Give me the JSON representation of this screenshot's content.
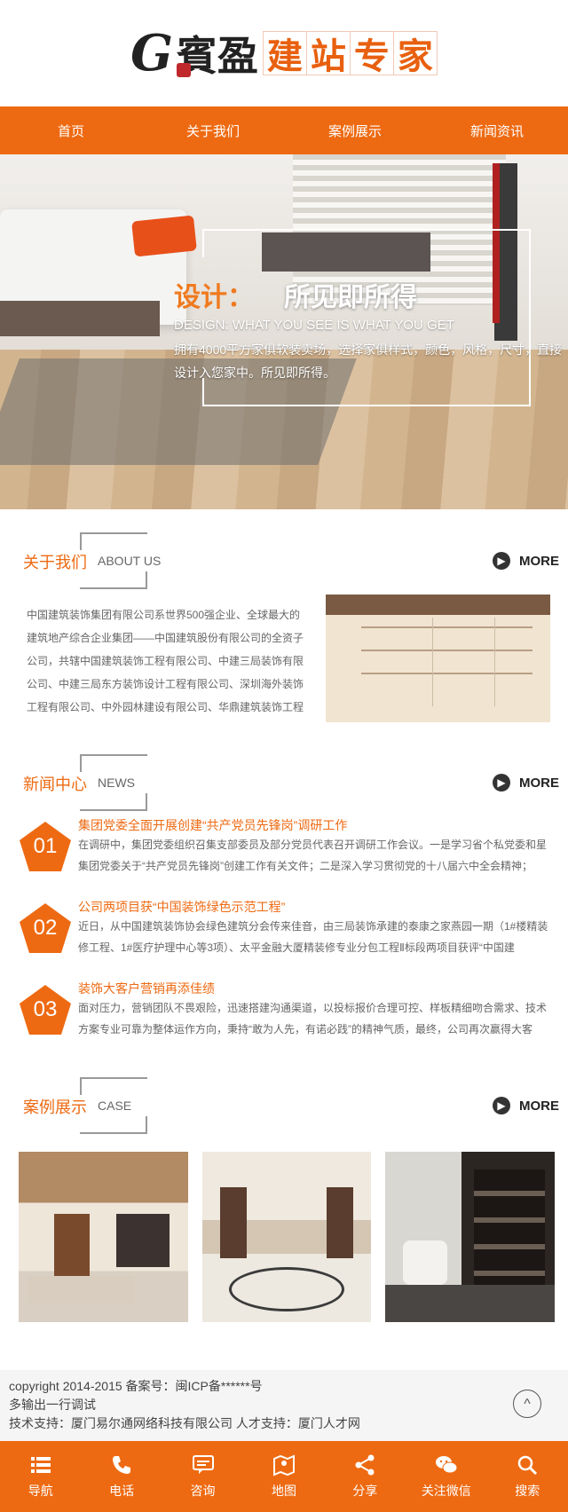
{
  "header": {
    "logo_mark": "G",
    "logo_word": "賓盈",
    "slogan": [
      "建",
      "站",
      "专",
      "家"
    ]
  },
  "nav": [
    "首页",
    "关于我们",
    "案例展示",
    "新闻资讯"
  ],
  "banner": {
    "title_orange": "设计：",
    "title_white": "所见即所得",
    "subtitle": "DESIGN: WHAT YOU SEE IS WHAT YOU GET",
    "desc": "拥有4000平方家俱软装卖场，选择家俱样式，颜色，风格，尺寸，直接设计入您家中。所见即所得。"
  },
  "about": {
    "title_cn": "关于我们",
    "title_en": "ABOUT US",
    "more": "MORE",
    "text": "中国建筑装饰集团有限公司系世界500强企业、全球最大的建筑地产综合企业集团——中国建筑股份有限公司的全资子公司，共辖中国建筑装饰工程有限公司、中建三局装饰有限公司、中建三局东方装饰设计工程有限公司、深圳海外装饰工程有限公司、中外园林建设有限公司、华鼎建筑装饰工程"
  },
  "news": {
    "title_cn": "新闻中心",
    "title_en": "NEWS",
    "more": "MORE",
    "items": [
      {
        "num": "01",
        "title": "集团党委全面开展创建“共产党员先锋岗”调研工作",
        "summary": "在调研中，集团党委组织召集支部委员及部分党员代表召开调研工作会议。一是学习省个私党委和星集团党委关于“共产党员先锋岗”创建工作有关文件；二是深入学习贯彻党的十八届六中全会精神；"
      },
      {
        "num": "02",
        "title": "公司两项目获“中国装饰绿色示范工程”",
        "summary": "近日，从中国建筑装饰协会绿色建筑分会传来佳音，由三局装饰承建的泰康之家燕园一期（1#楼精装修工程、1#医疗护理中心等3项）、太平金融大厦精装修专业分包工程Ⅱ标段两项目获评“中国建"
      },
      {
        "num": "03",
        "title": "装饰大客户营销再添佳绩",
        "summary": "面对压力，营销团队不畏艰险，迅速搭建沟通渠道，以投标报价合理可控、样板精细吻合需求、技术方案专业可靠为整体运作方向，秉持“敢为人先，有诺必践”的精神气质，最终，公司再次赢得大客"
      }
    ]
  },
  "cases": {
    "title_cn": "案例展示",
    "title_en": "CASE",
    "more": "MORE"
  },
  "footer": {
    "line1": "copyright 2014-2015 备案号：闽ICP备******号",
    "line2": "多输出一行调试",
    "line3": "技术支持：厦门易尔通网络科技有限公司 人才支持：厦门人才网",
    "top_label": "^"
  },
  "bottombar": [
    {
      "label": "导航",
      "icon": "menu-icon"
    },
    {
      "label": "电话",
      "icon": "phone-icon"
    },
    {
      "label": "咨询",
      "icon": "chat-icon"
    },
    {
      "label": "地图",
      "icon": "map-icon"
    },
    {
      "label": "分享",
      "icon": "share-icon"
    },
    {
      "label": "关注微信",
      "icon": "wechat-icon"
    },
    {
      "label": "搜索",
      "icon": "search-icon"
    }
  ],
  "colors": {
    "accent": "#ee6a12",
    "footer_bg": "#f6f5f5"
  }
}
